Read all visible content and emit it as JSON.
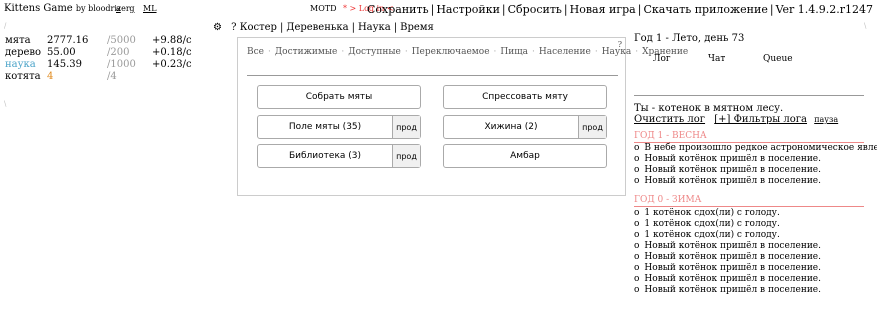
{
  "topbar": {
    "title": "Kittens Game",
    "by": "by bloodrizer",
    "links": [
      "a",
      "g",
      "ML"
    ],
    "motd": "MOTD",
    "login": "* > Log in <",
    "menu": [
      "Сохранить",
      "Настройки",
      "Сбросить",
      "Новая игра",
      "Скачать приложение",
      "Ver 1.4.9.2.r1247"
    ]
  },
  "resources": [
    {
      "name": "мята",
      "value": "2777.16",
      "max": "/5000",
      "rate": "+9.88/с",
      "color": "#000000"
    },
    {
      "name": "дерево",
      "value": "55.00",
      "max": "/200",
      "rate": "+0.18/с",
      "color": "#000000"
    },
    {
      "name": "наука",
      "value": "145.39",
      "max": "/1000",
      "rate": "+0.23/с",
      "color": "#4aa3c8"
    },
    {
      "name": "котята",
      "value": "4",
      "max": "/4",
      "rate": "",
      "color": "#000000",
      "value_color": "#e08a1e"
    }
  ],
  "tabs": {
    "gear_icon": "gear-icon",
    "help": "?",
    "items": [
      "Костер",
      "Деревенька",
      "Наука",
      "Время"
    ]
  },
  "filters": {
    "items": [
      "Все",
      "Достижимые",
      "Доступные",
      "Переключаемое",
      "Пища",
      "Население",
      "Наука",
      "Хранение"
    ],
    "help": "?"
  },
  "buttons": {
    "gather": "Собрать мяты",
    "refine": "Спрессовать мяту",
    "field": "Поле мяты (35)",
    "hut": "Хижина (2)",
    "library": "Библиотека (3)",
    "barn": "Амбар",
    "sell": "прод"
  },
  "log": {
    "season": "Год 1 - Лето, день 73",
    "tabs": [
      "Лог",
      "Чат",
      "Queue"
    ],
    "kitten_msg": "Ты - котенок в мятном лесу.",
    "clear": "Очистить лог",
    "filters": "[+] Фильтры лога",
    "pause": "пауза",
    "year1_head": "ГОД 1 - ВЕСНА",
    "year1": [
      "В небе произошло редкое астрономическое явление",
      "Новый котёнок пришёл в поселение.",
      "Новый котёнок пришёл в поселение.",
      "Новый котёнок пришёл в поселение."
    ],
    "year0_head": "ГОД 0 - ЗИМА",
    "year0": [
      "1 котёнок сдох(ли) с голоду.",
      "1 котёнок сдох(ли) с голоду.",
      "1 котёнок сдох(ли) с голоду.",
      "Новый котёнок пришёл в поселение.",
      "Новый котёнок пришёл в поселение.",
      "Новый котёнок пришёл в поселение.",
      "Новый котёнок пришёл в поселение.",
      "Новый котёнок пришёл в поселение."
    ]
  }
}
